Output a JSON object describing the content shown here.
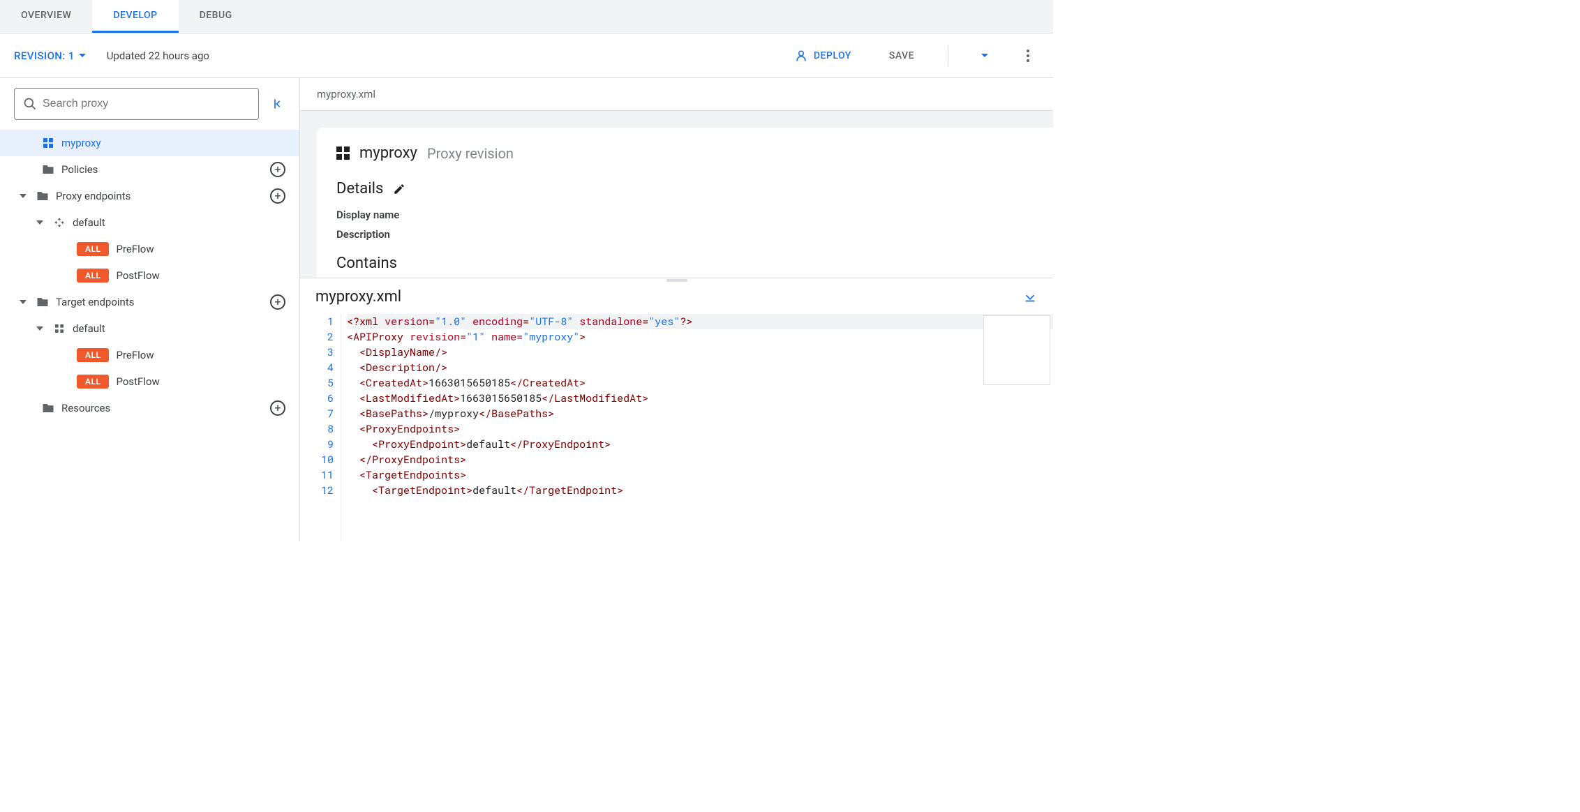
{
  "tabs": {
    "overview": "OVERVIEW",
    "develop": "DEVELOP",
    "debug": "DEBUG",
    "active": "develop"
  },
  "subheader": {
    "revision_label": "REVISION: 1",
    "updated": "Updated 22 hours ago",
    "deploy": "DEPLOY",
    "save": "SAVE"
  },
  "sidebar": {
    "search_placeholder": "Search proxy",
    "myproxy": "myproxy",
    "policies": "Policies",
    "proxy_endpoints": "Proxy endpoints",
    "proxy_default": "default",
    "badge_all": "ALL",
    "preflow": "PreFlow",
    "postflow": "PostFlow",
    "target_endpoints": "Target endpoints",
    "target_default": "default",
    "resources": "Resources"
  },
  "content": {
    "breadcrumb": "myproxy.xml",
    "proxy_name": "myproxy",
    "proxy_sub": "Proxy revision",
    "details": "Details",
    "display_name": "Display name",
    "description": "Description",
    "contains": "Contains"
  },
  "editor": {
    "title": "myproxy.xml",
    "lines": [
      "1",
      "2",
      "3",
      "4",
      "5",
      "6",
      "7",
      "8",
      "9",
      "10",
      "11",
      "12"
    ],
    "xml": {
      "version": "1.0",
      "encoding": "UTF-8",
      "standalone": "yes",
      "revision_attr": "1",
      "name_attr": "myproxy",
      "created_at": "1663015650185",
      "last_modified_at": "1663015650185",
      "base_path": "/myproxy",
      "proxy_endpoint": "default",
      "target_endpoint": "default"
    }
  }
}
